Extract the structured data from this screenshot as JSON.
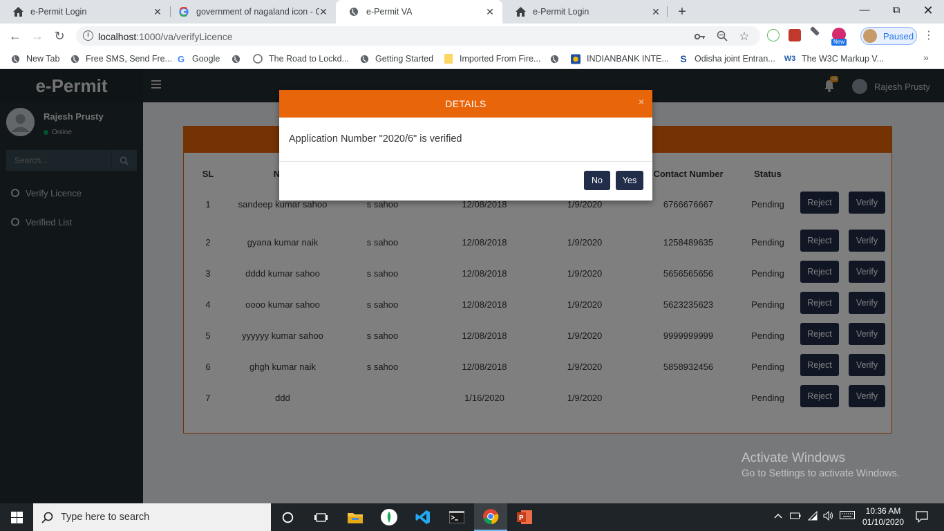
{
  "browser": {
    "tabs": [
      {
        "title": "e-Permit Login",
        "icon": "home-icon",
        "active": false
      },
      {
        "title": "government of nagaland icon - G",
        "icon": "google-icon",
        "active": false
      },
      {
        "title": "e-Permit VA",
        "icon": "globe-icon",
        "active": true
      },
      {
        "title": "e-Permit Login",
        "icon": "home-icon",
        "active": false
      }
    ],
    "url_host": "localhost",
    "url_path": ":1000/va/verifyLicence",
    "profile_status": "Paused",
    "ext_badge_new": "New",
    "bookmarks": [
      {
        "label": "New Tab",
        "icon": "globe-icon"
      },
      {
        "label": "Free SMS, Send Fre...",
        "icon": "globe-icon"
      },
      {
        "label": "Google",
        "icon": "google-icon"
      },
      {
        "label": "",
        "icon": "globe-icon"
      },
      {
        "label": "The Road to Lockd...",
        "icon": "circle-icon"
      },
      {
        "label": "Getting Started",
        "icon": "globe-icon"
      },
      {
        "label": "Imported From Fire...",
        "icon": "folder-icon"
      },
      {
        "label": "",
        "icon": "globe-icon"
      },
      {
        "label": "INDIANBANK INTE...",
        "icon": "bank-icon"
      },
      {
        "label": "Odisha joint Entran...",
        "icon": "s-icon"
      },
      {
        "label": "The W3C Markup V...",
        "icon": "w3c-icon"
      }
    ]
  },
  "app": {
    "logo": "e-Permit",
    "notification_count": "18",
    "user_name": "Rajesh Prusty",
    "user_status": "Online",
    "search_placeholder": "Search...",
    "menu": [
      {
        "label": "Verify Licence"
      },
      {
        "label": "Verified List"
      }
    ],
    "table": {
      "headers": [
        "SL",
        "Na",
        "",
        "",
        "",
        "Contact Number",
        "Status"
      ],
      "rows": [
        {
          "sl": "1",
          "name": "sandeep kumar sahoo",
          "father": "s sahoo",
          "dob": "12/08/2018",
          "date": "1/9/2020",
          "contact": "6766676667",
          "status": "Pending"
        },
        {
          "sl": "2",
          "name": "gyana kumar naik",
          "father": "s sahoo",
          "dob": "12/08/2018",
          "date": "1/9/2020",
          "contact": "1258489635",
          "status": "Pending"
        },
        {
          "sl": "3",
          "name": "dddd kumar sahoo",
          "father": "s sahoo",
          "dob": "12/08/2018",
          "date": "1/9/2020",
          "contact": "5656565656",
          "status": "Pending"
        },
        {
          "sl": "4",
          "name": "oooo kumar sahoo",
          "father": "s sahoo",
          "dob": "12/08/2018",
          "date": "1/9/2020",
          "contact": "5623235623",
          "status": "Pending"
        },
        {
          "sl": "5",
          "name": "yyyyyy kumar sahoo",
          "father": "s sahoo",
          "dob": "12/08/2018",
          "date": "1/9/2020",
          "contact": "9999999999",
          "status": "Pending"
        },
        {
          "sl": "6",
          "name": "ghgh kumar naik",
          "father": "s sahoo",
          "dob": "12/08/2018",
          "date": "1/9/2020",
          "contact": "5858932456",
          "status": "Pending"
        },
        {
          "sl": "7",
          "name": "ddd",
          "father": "",
          "dob": "1/16/2020",
          "date": "1/9/2020",
          "contact": "",
          "status": "Pending"
        }
      ],
      "reject_label": "Reject",
      "verify_label": "Verify"
    }
  },
  "modal": {
    "title": "DETAILS",
    "close": "×",
    "message": "Application Number \"2020/6\" is verified",
    "no_label": "No",
    "yes_label": "Yes"
  },
  "watermark": {
    "line1": "Activate Windows",
    "line2": "Go to Settings to activate Windows."
  },
  "taskbar": {
    "search_text": "Type here to search",
    "time": "10:36 AM",
    "date": "01/10/2020",
    "apps": [
      "task-view-icon",
      "file-explorer-icon",
      "mongodb-compass-icon",
      "vscode-icon",
      "terminal-icon",
      "chrome-icon",
      "powerpoint-icon"
    ]
  },
  "colors": {
    "accent_orange": "#e8650a",
    "navy_button": "#222d4a",
    "sidebar": "#222d32"
  }
}
